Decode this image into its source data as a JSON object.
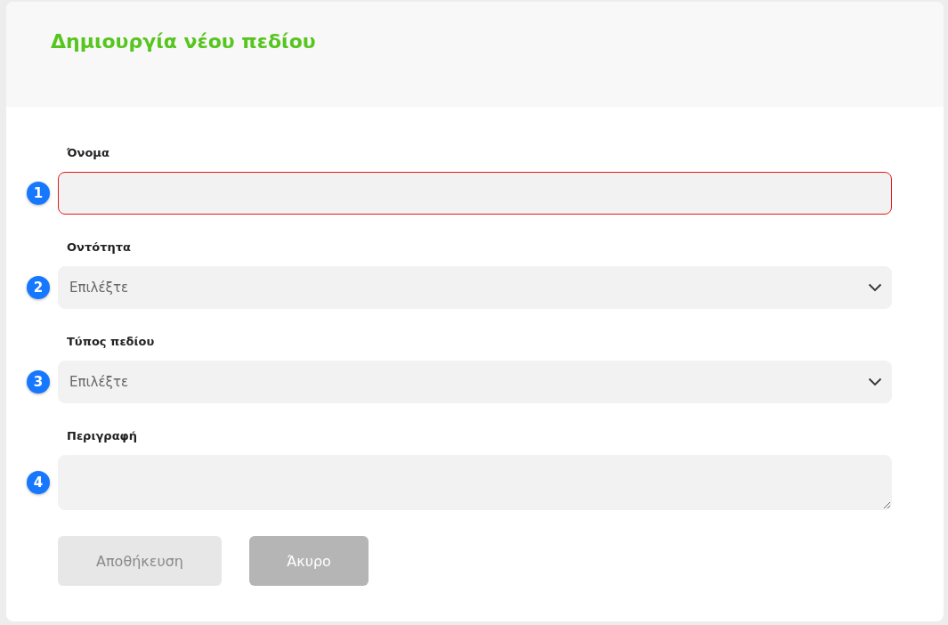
{
  "title": "Δημιουργία νέου πεδίου",
  "fields": [
    {
      "kind": "text",
      "label": "Όνομα",
      "step": "1",
      "error": true
    },
    {
      "kind": "select",
      "label": "Οντότητα",
      "step": "2",
      "error": false,
      "placeholder": "Επιλέξτε"
    },
    {
      "kind": "select",
      "label": "Τύπος πεδίου",
      "step": "3",
      "error": false,
      "placeholder": "Επιλέξτε"
    },
    {
      "kind": "textarea",
      "label": "Περιγραφή",
      "step": "4",
      "error": false
    }
  ],
  "buttons": [
    {
      "label": "Αποθήκευση",
      "disabled": true
    },
    {
      "label": "Άκυρο",
      "disabled": false
    }
  ]
}
